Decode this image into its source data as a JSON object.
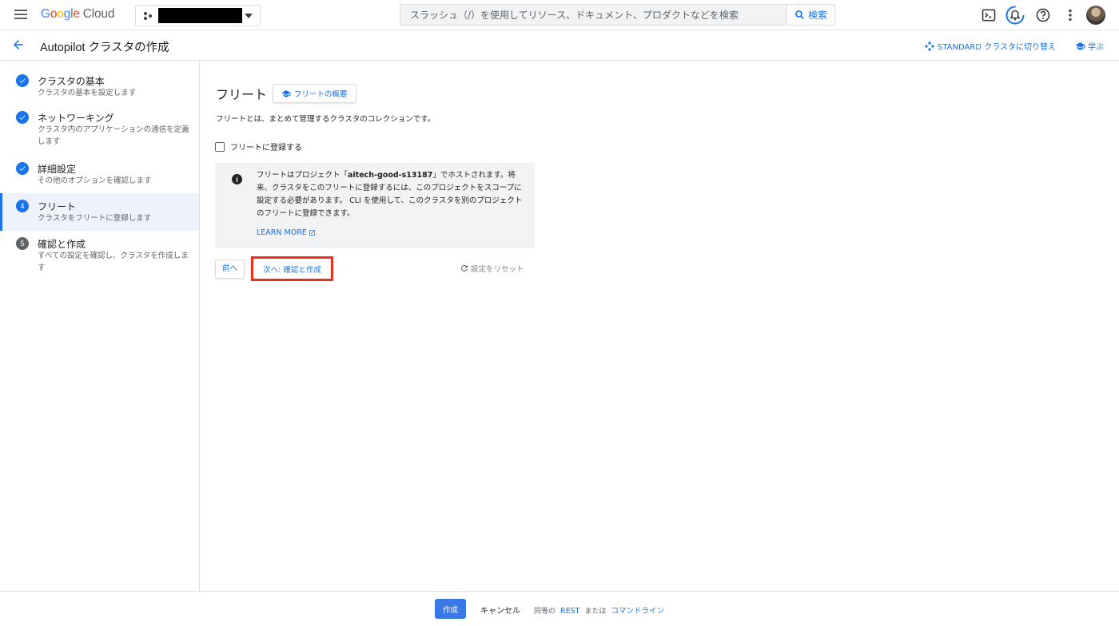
{
  "topbar": {
    "brand": {
      "g1": "G",
      "g2": "o",
      "g3": "o",
      "g4": "g",
      "g5": "l",
      "g6": "e",
      "cloud": "Cloud"
    },
    "search_placeholder": "スラッシュ（/）を使用してリソース、ドキュメント、プロダクトなどを検索",
    "search_button": "検索"
  },
  "subbar": {
    "title": "Autopilot クラスタの作成",
    "switch_standard": "STANDARD クラスタに切り替え",
    "learn": "学ぶ"
  },
  "steps": [
    {
      "num": "1",
      "title": "クラスタの基本",
      "desc": "クラスタの基本を設定します",
      "state": "done"
    },
    {
      "num": "2",
      "title": "ネットワーキング",
      "desc": "クラスタ内のアプリケーションの通信を定義します",
      "state": "done"
    },
    {
      "num": "3",
      "title": "詳細設定",
      "desc": "その他のオプションを確認します",
      "state": "done"
    },
    {
      "num": "4",
      "title": "フリート",
      "desc": "クラスタをフリートに登録します",
      "state": "current"
    },
    {
      "num": "5",
      "title": "確認と作成",
      "desc": "すべての設定を確認し、クラスタを作成します",
      "state": "todo"
    }
  ],
  "main": {
    "heading": "フリート",
    "overview_button": "フリートの概要",
    "intro": "フリートとは、まとめて管理するクラスタのコレクションです。",
    "checkbox_label": "フリートに登録する",
    "info_prefix": "フリートはプロジェクト「",
    "info_project": "aitech-good-s13187",
    "info_suffix": "」でホストされます。将来、クラスタをこのフリートに登録するには、このプロジェクトをスコープに設定する必要があります。 CLI を使用して、このクラスタを別のプロジェクトのフリートに登録できます。",
    "learn_more": "LEARN MORE",
    "prev_button": "前へ",
    "next_button": "次へ: 確認と作成",
    "reset": "設定をリセット"
  },
  "footer": {
    "create": "作成",
    "cancel": "キャンセル",
    "equivalent": "同等の",
    "rest": "REST",
    "or": "または",
    "command_line": "コマンドライン"
  },
  "colors": {
    "accent": "#1a73e8",
    "highlight_border": "#e8311a",
    "primary_button": "#3b78e7"
  }
}
